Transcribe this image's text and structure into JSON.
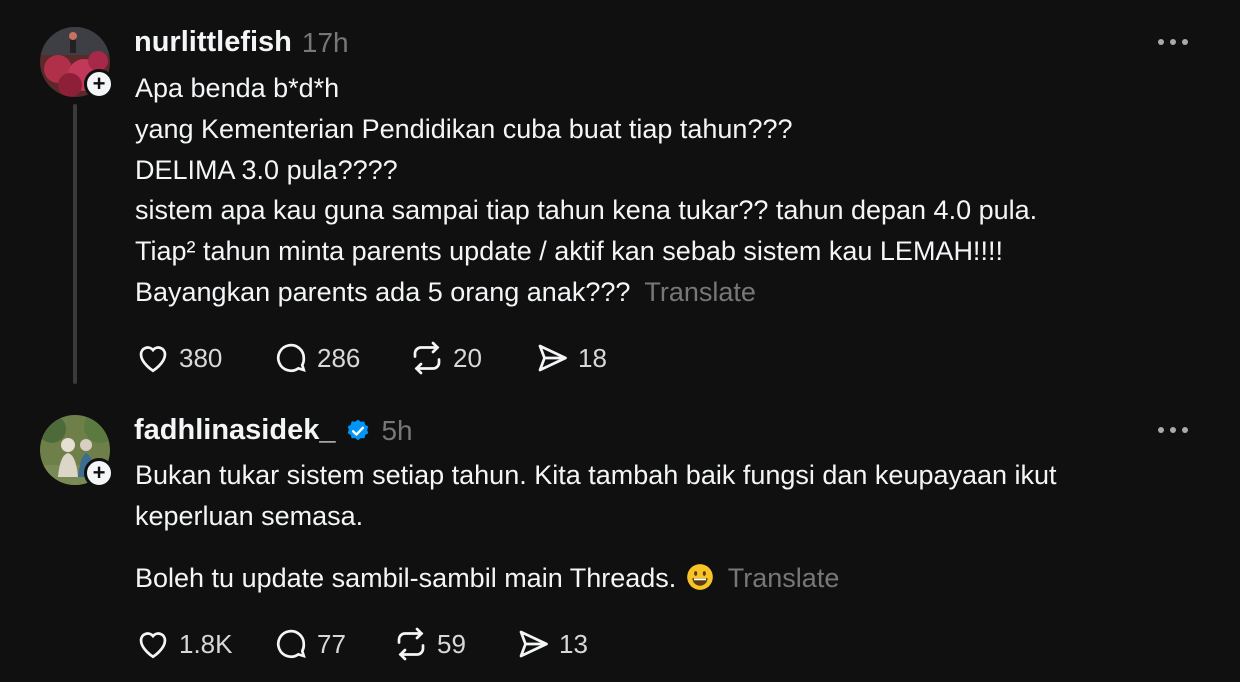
{
  "posts": [
    {
      "username": "nurlittlefish",
      "time": "17h",
      "verified": false,
      "lines": [
        "Apa benda b*d*h",
        "yang Kementerian Pendidikan cuba buat tiap tahun???",
        "DELIMA 3.0 pula????",
        "sistem apa kau guna sampai tiap tahun kena tukar?? tahun depan 4.0 pula.",
        "Tiap² tahun minta parents update / aktif kan sebab sistem kau LEMAH!!!!",
        "Bayangkan parents ada 5 orang anak???"
      ],
      "translate": "Translate",
      "likes": "380",
      "replies": "286",
      "reposts": "20",
      "shares": "18"
    },
    {
      "username": "fadhlinasidek_",
      "time": "5h",
      "verified": true,
      "lines": [
        "Bukan tukar sistem setiap tahun. Kita tambah baik fungsi dan keupayaan ikut",
        "keperluan semasa.",
        "Boleh tu update sambil-sambil main Threads."
      ],
      "translate": "Translate",
      "likes": "1.8K",
      "replies": "77",
      "reposts": "59",
      "shares": "13"
    }
  ],
  "icons": {
    "like": "heart-icon",
    "reply": "comment-icon",
    "repost": "repost-icon",
    "share": "send-icon",
    "more": "more-dots-icon",
    "follow": "plus-icon",
    "verified": "verified-badge-icon",
    "emoji": "grinning-face-emoji"
  },
  "colors": {
    "background": "#101010",
    "text": "#f3f5f7",
    "muted": "#777777",
    "verified": "#0095f6"
  }
}
